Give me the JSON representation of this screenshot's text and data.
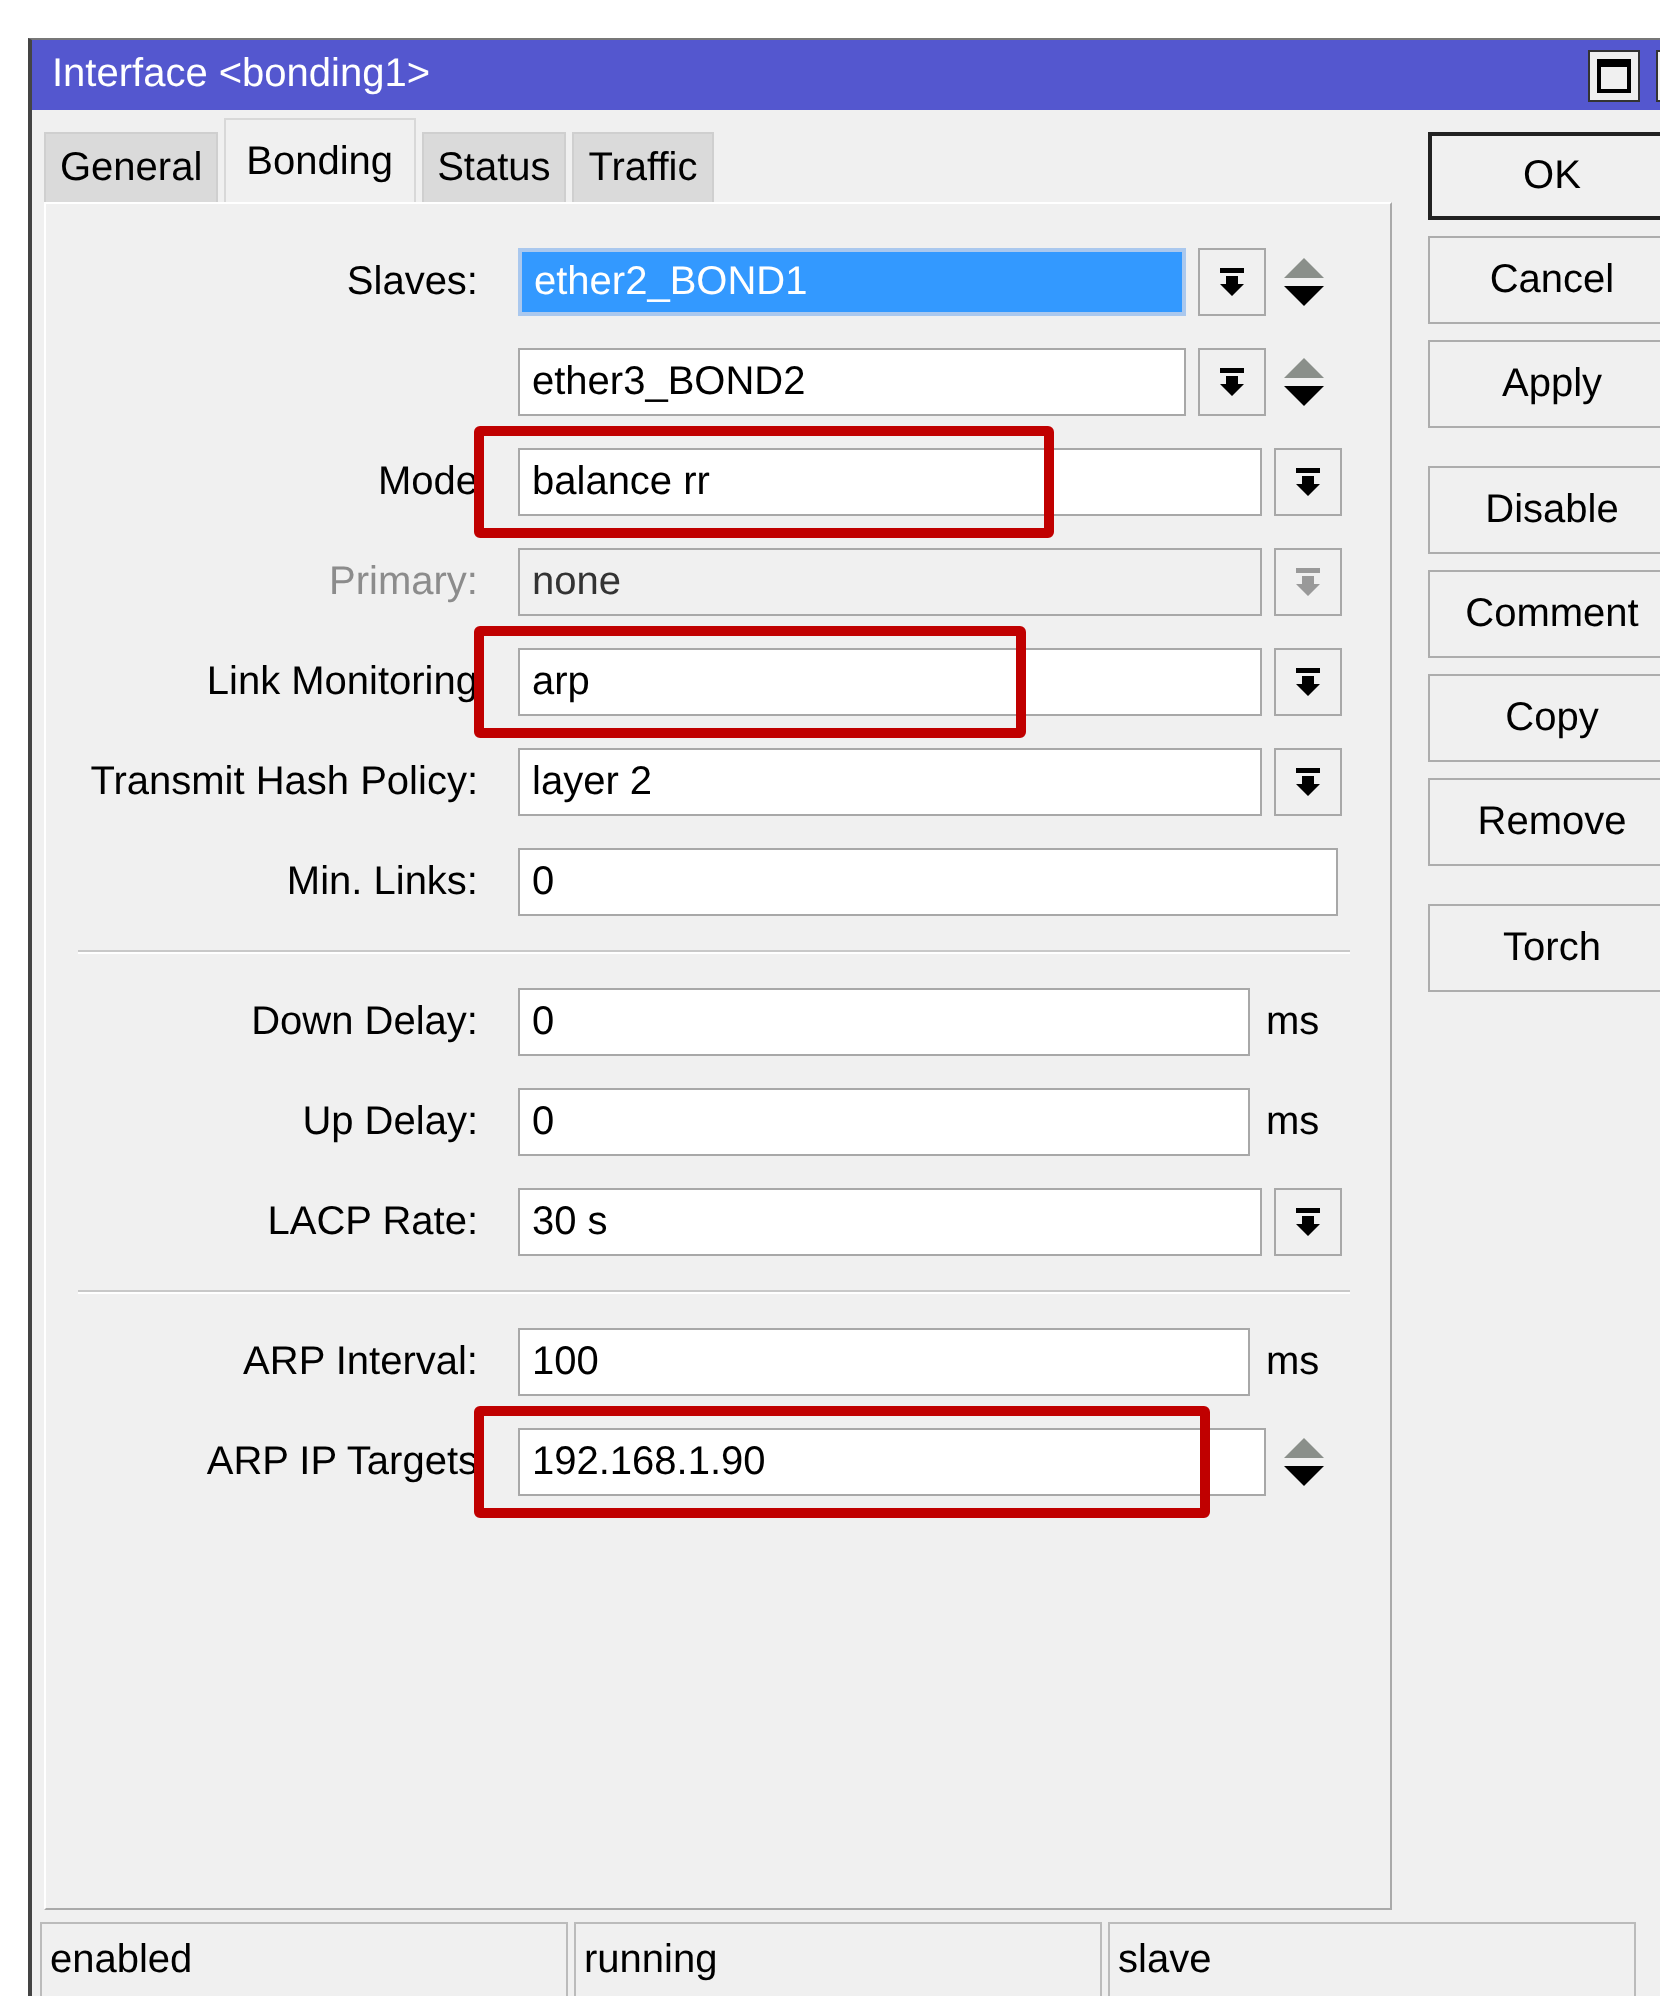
{
  "window": {
    "title": "Interface <bonding1>"
  },
  "tabs": [
    {
      "label": "General",
      "selected": false
    },
    {
      "label": "Bonding",
      "selected": true
    },
    {
      "label": "Status",
      "selected": false
    },
    {
      "label": "Traffic",
      "selected": false
    }
  ],
  "rows": [
    {
      "kind": "combo-updown",
      "label": "Slaves:",
      "value": "ether2_BOND1",
      "selected": true,
      "disabled": false
    },
    {
      "kind": "combo-updown",
      "value": "ether3_BOND2",
      "selected": false,
      "disabled": false
    },
    {
      "kind": "dropdown",
      "label": "Mode",
      "value": "balance rr",
      "disabled": false,
      "highlighted": true
    },
    {
      "kind": "dropdown",
      "label": "Primary:",
      "value": "none",
      "disabled": true
    },
    {
      "kind": "dropdown",
      "label": "Link Monitoring",
      "value": "arp",
      "disabled": false,
      "highlighted": true
    },
    {
      "kind": "dropdown",
      "label": "Transmit Hash Policy:",
      "value": "layer 2",
      "disabled": false
    },
    {
      "kind": "text",
      "label": "Min. Links:",
      "value": "0",
      "disabled": false
    },
    {
      "kind": "separator"
    },
    {
      "kind": "text-unit",
      "label": "Down Delay:",
      "value": "0",
      "unit": "ms",
      "disabled": false
    },
    {
      "kind": "text-unit",
      "label": "Up Delay:",
      "value": "0",
      "unit": "ms",
      "disabled": false
    },
    {
      "kind": "dropdown",
      "label": "LACP Rate:",
      "value": "30 s",
      "disabled": false
    },
    {
      "kind": "separator"
    },
    {
      "kind": "text-unit",
      "label": "ARP Interval:",
      "value": "100",
      "unit": "ms",
      "disabled": false
    },
    {
      "kind": "text-updown",
      "label": "ARP IP Targets",
      "value": "192.168.1.90",
      "disabled": false,
      "highlighted": true
    }
  ],
  "button_groups": [
    [
      {
        "label": "OK",
        "default": true
      },
      {
        "label": "Cancel",
        "default": false
      },
      {
        "label": "Apply",
        "default": false
      }
    ],
    [
      {
        "label": "Disable",
        "default": false
      },
      {
        "label": "Comment",
        "default": false
      },
      {
        "label": "Copy",
        "default": false
      },
      {
        "label": "Remove",
        "default": false
      }
    ],
    [
      {
        "label": "Torch",
        "default": false
      }
    ]
  ],
  "status_bar": [
    "enabled",
    "running",
    "slave"
  ]
}
